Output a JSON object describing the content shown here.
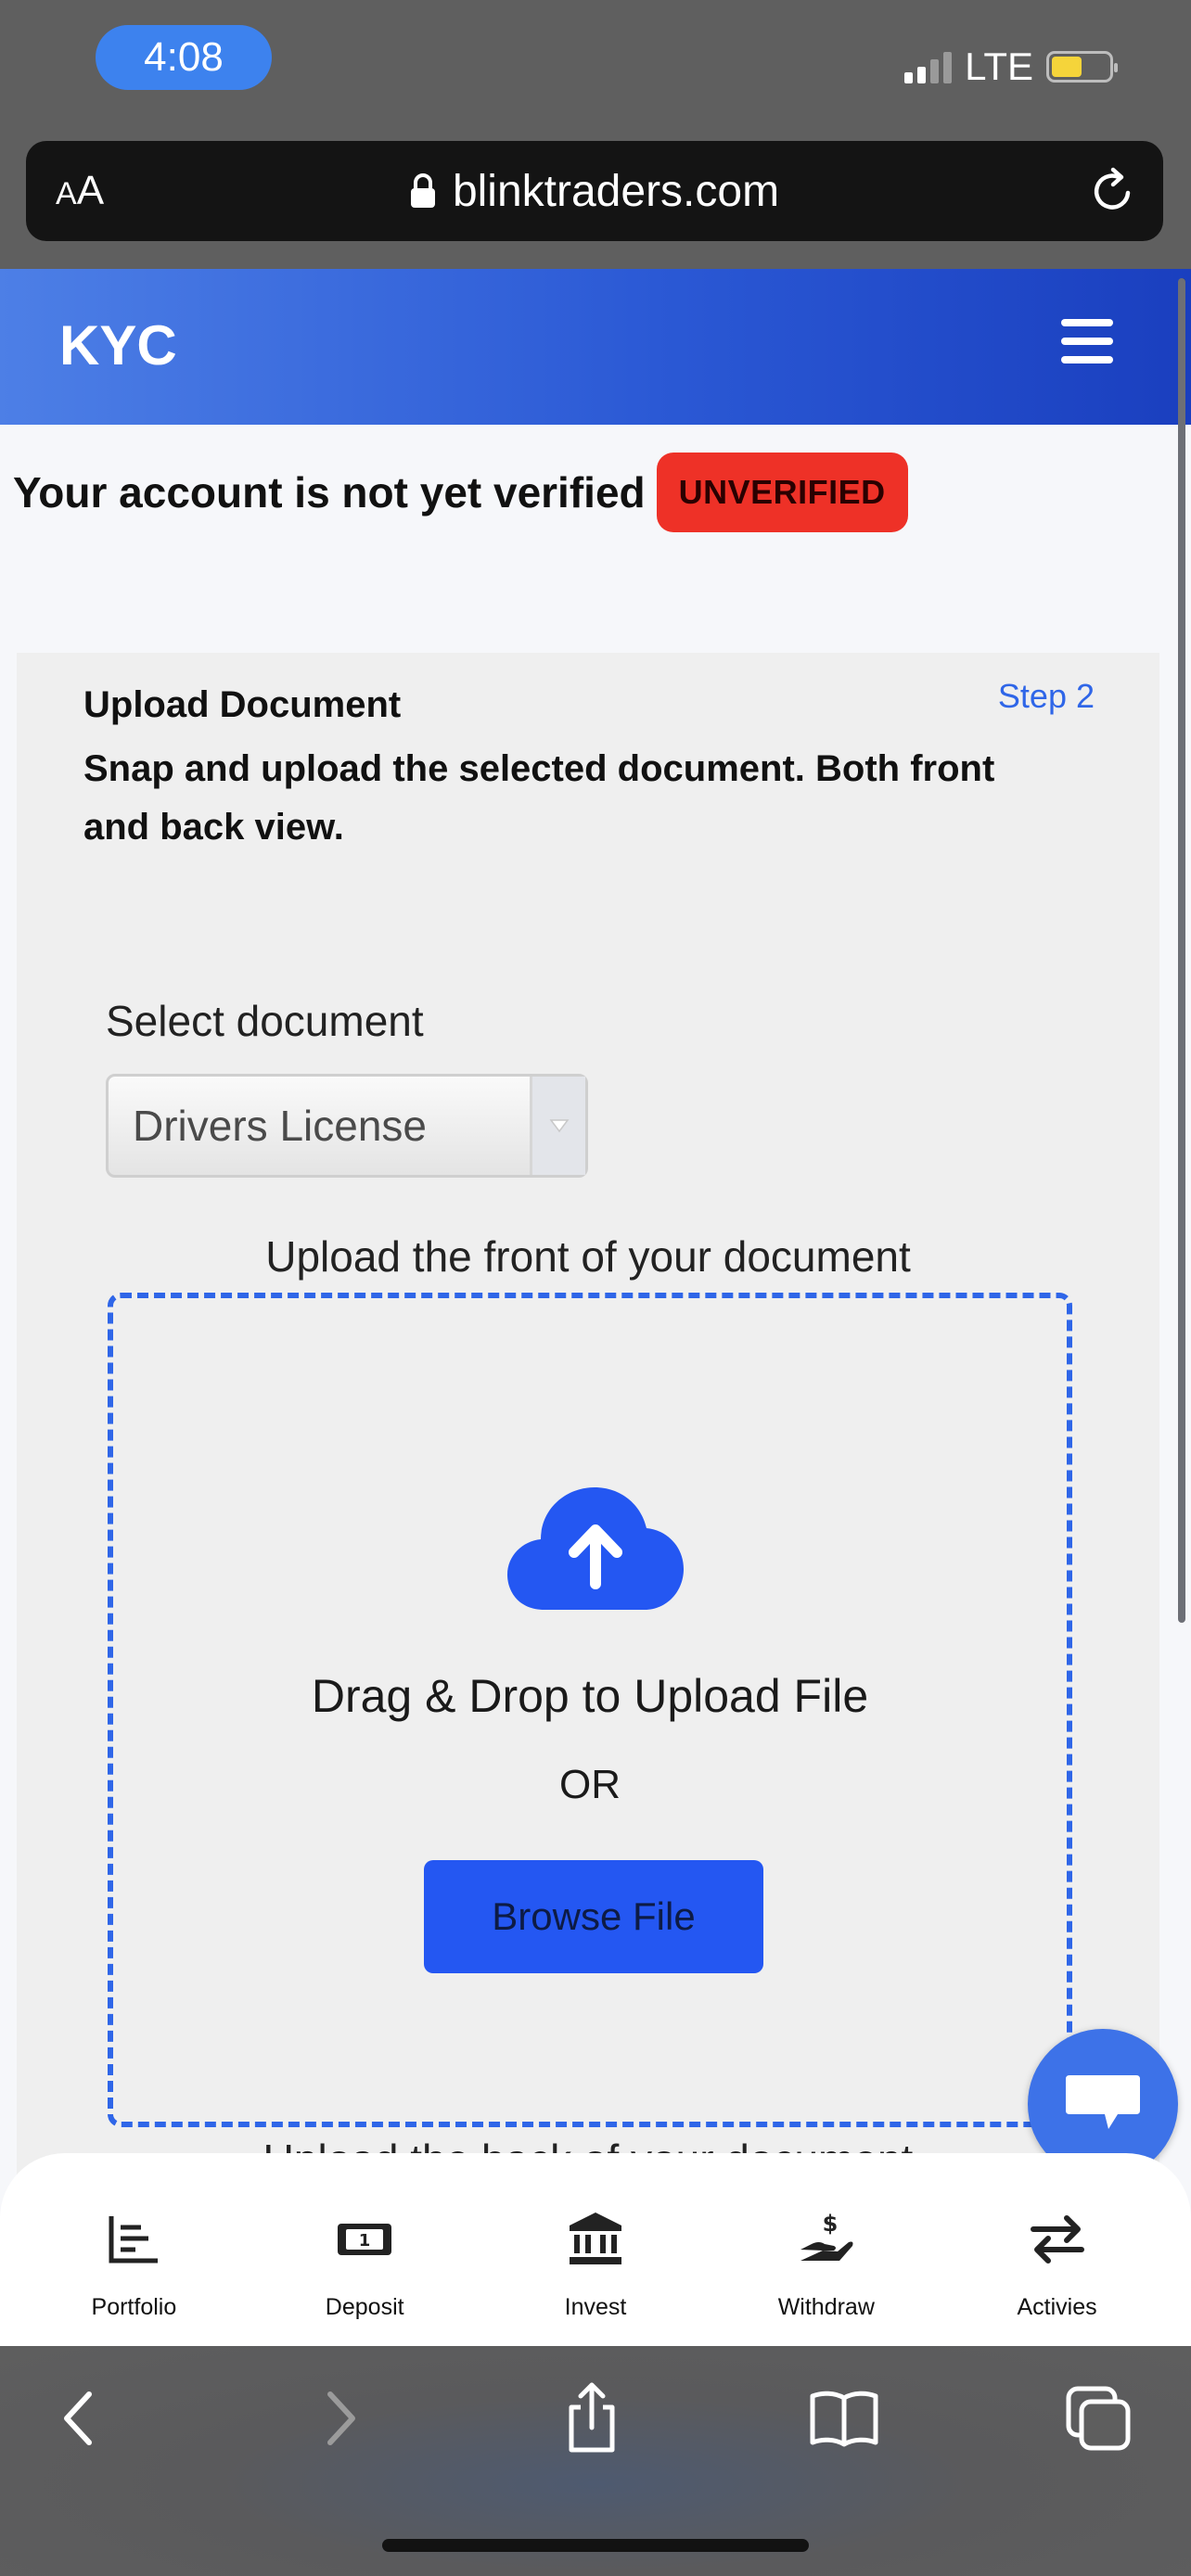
{
  "status_bar": {
    "time": "4:08",
    "network": "LTE"
  },
  "browser": {
    "text_size_label": "AA",
    "url": "blinktraders.com"
  },
  "header": {
    "title": "KYC"
  },
  "verification": {
    "message": "Your account is not yet verified",
    "badge": "UNVERIFIED",
    "badge_color": "#ee3127"
  },
  "upload_card": {
    "title": "Upload Document",
    "step": "Step 2",
    "description": "Snap and upload the selected document. Both front and back view.",
    "select_label": "Select document",
    "selected_document": "Drivers License",
    "front_label": "Upload the front of your document",
    "drag_text": "Drag & Drop to Upload File",
    "or_text": "OR",
    "browse_button": "Browse File",
    "back_label": "Upload the back of your document",
    "accent_color": "#2f66e8"
  },
  "bottom_nav": {
    "items": [
      {
        "label": "Portfolio",
        "icon": "chart-icon"
      },
      {
        "label": "Deposit",
        "icon": "banknote-icon"
      },
      {
        "label": "Invest",
        "icon": "bank-icon"
      },
      {
        "label": "Withdraw",
        "icon": "hand-dollar-icon"
      },
      {
        "label": "Activies",
        "icon": "swap-arrows-icon"
      }
    ]
  }
}
